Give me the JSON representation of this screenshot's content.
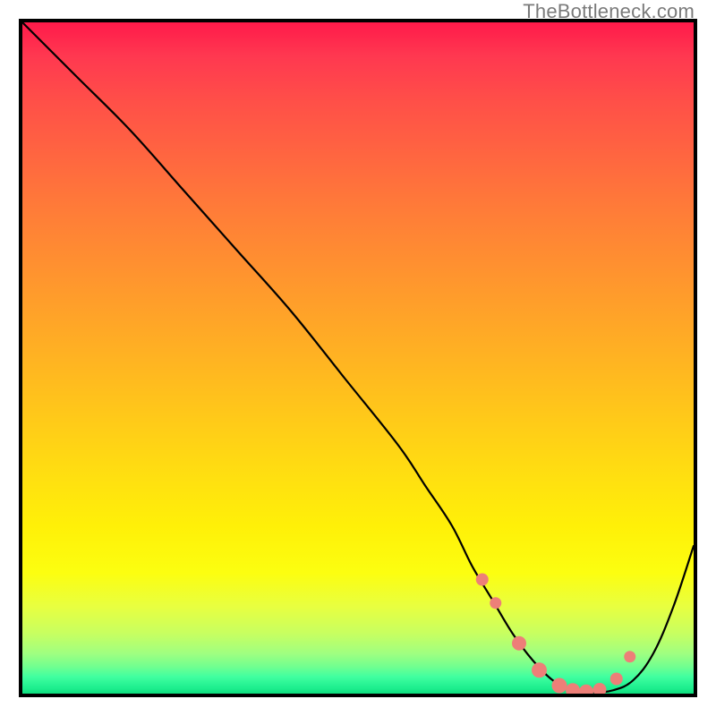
{
  "watermark": "TheBottleneck.com",
  "chart_data": {
    "type": "line",
    "title": "",
    "xlabel": "",
    "ylabel": "",
    "xlim": [
      0,
      100
    ],
    "ylim": [
      0,
      100
    ],
    "series": [
      {
        "name": "curve",
        "x": [
          0,
          8,
          16,
          24,
          32,
          40,
          48,
          56,
          60,
          64,
          67,
          70,
          73,
          76,
          79,
          82,
          85,
          88,
          91,
          94,
          97,
          100
        ],
        "values": [
          100,
          92,
          84,
          75,
          66,
          57,
          47,
          37,
          31,
          25,
          19,
          14,
          9,
          5,
          2,
          0.5,
          0.2,
          0.5,
          2,
          6,
          13,
          22
        ]
      }
    ],
    "markers": {
      "name": "highlight-dots",
      "x": [
        68.5,
        70.5,
        74,
        77,
        80,
        82,
        84,
        86,
        88.5,
        90.5
      ],
      "values": [
        17,
        13.5,
        7.5,
        3.5,
        1.2,
        0.5,
        0.3,
        0.6,
        2.2,
        5.5
      ],
      "color": "#ed7f78",
      "size": "mixed"
    },
    "background": {
      "type": "vertical-gradient",
      "stops": [
        {
          "pos": 0.0,
          "color": "#ff1a4a"
        },
        {
          "pos": 0.2,
          "color": "#ff6640"
        },
        {
          "pos": 0.4,
          "color": "#ffaa28"
        },
        {
          "pos": 0.6,
          "color": "#ffdd12"
        },
        {
          "pos": 0.8,
          "color": "#f8ff20"
        },
        {
          "pos": 0.95,
          "color": "#90ff80"
        },
        {
          "pos": 1.0,
          "color": "#10e080"
        }
      ]
    }
  }
}
